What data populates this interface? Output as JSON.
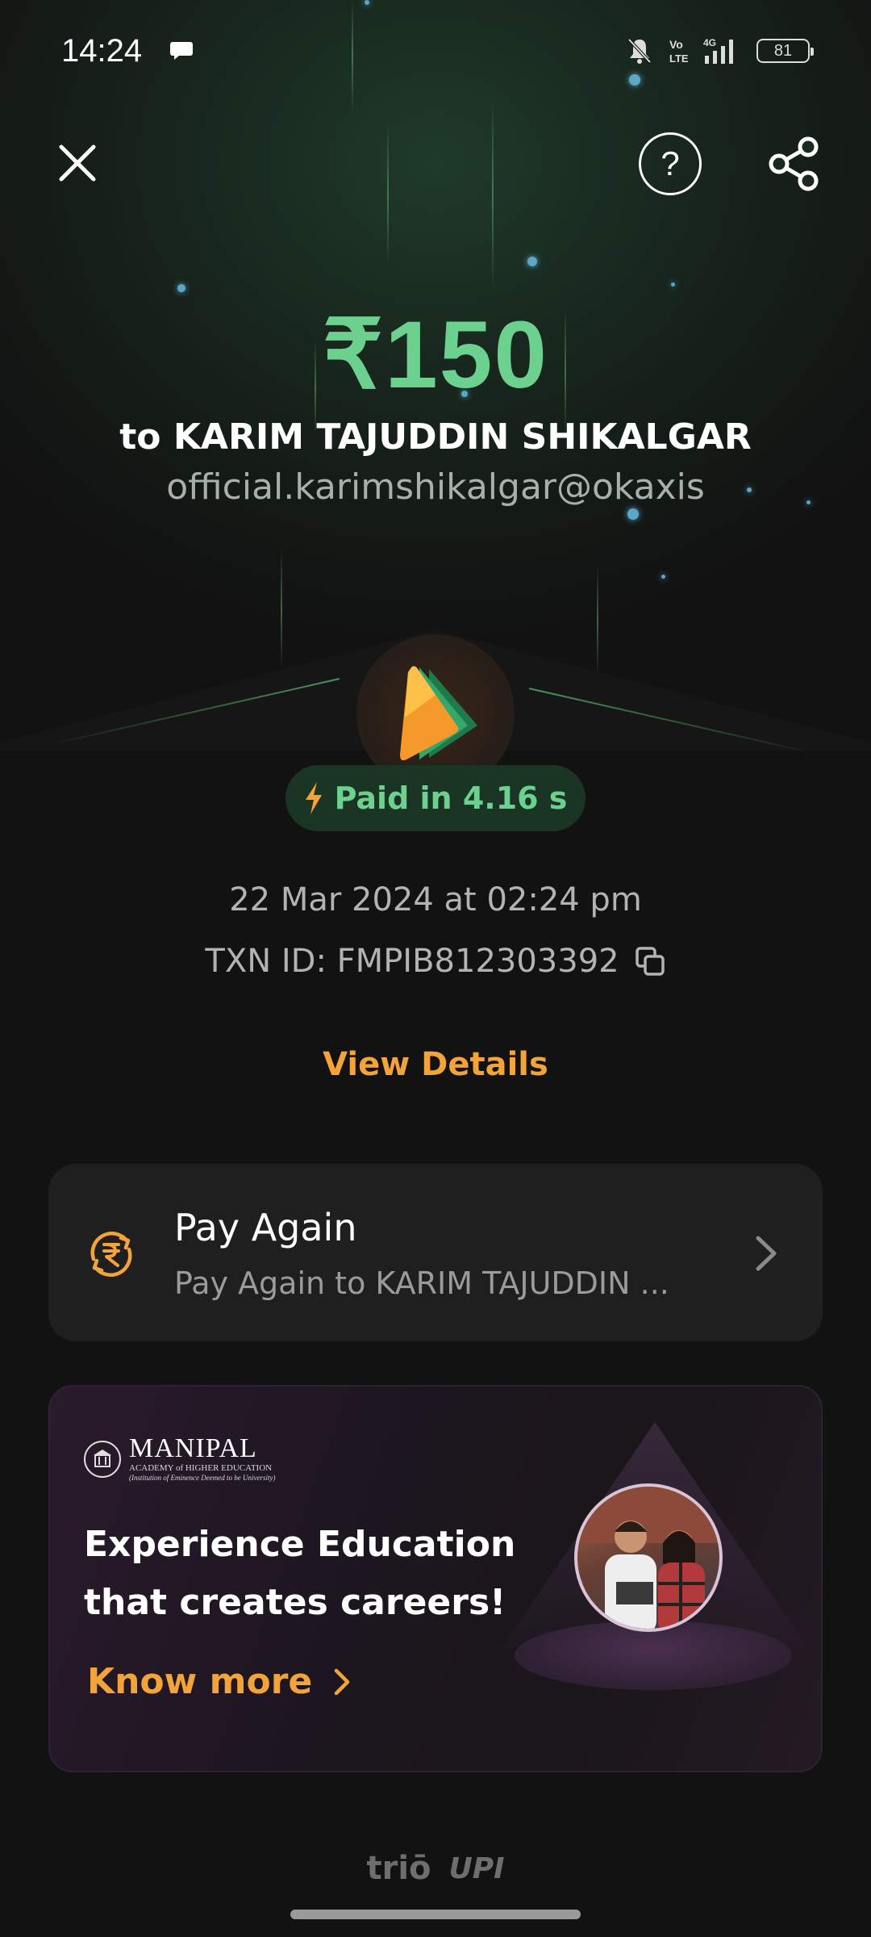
{
  "status_bar": {
    "time": "14:24",
    "battery": "81",
    "icons": [
      "chat-icon",
      "mute-icon",
      "volte-icon",
      "4g-signal-icon",
      "battery-icon"
    ]
  },
  "header": {
    "close_icon": "close-icon",
    "help_icon": "help-icon",
    "help_label": "?",
    "share_icon": "share-icon"
  },
  "transaction": {
    "amount": "₹150",
    "payee": "to KARIM TAJUDDIN SHIKALGAR",
    "upi_id": "official.karimshikalgar@okaxis",
    "paid_badge": "Paid in 4.16 s",
    "date": "22 Mar 2024 at 02:24 pm",
    "txn_id": "TXN ID: FMPIB812303392",
    "view_details": "View Details"
  },
  "pay_again": {
    "title": "Pay Again",
    "subtitle": "Pay Again to KARIM TAJUDDIN ..."
  },
  "ad": {
    "brand": "MANIPAL",
    "brand_sub": "ACADEMY of HIGHER EDUCATION",
    "brand_tagline": "(Institution of Eminence Deemed to be University)",
    "headline_line1": "Experience Education",
    "headline_line2": "that creates careers!",
    "cta": "Know more"
  },
  "footer": {
    "brand1": "triō",
    "brand2": "UPI"
  },
  "colors": {
    "accent_green": "#6cd08f",
    "accent_orange": "#f2a33a",
    "background": "#121212",
    "card": "#1f1f1f"
  }
}
